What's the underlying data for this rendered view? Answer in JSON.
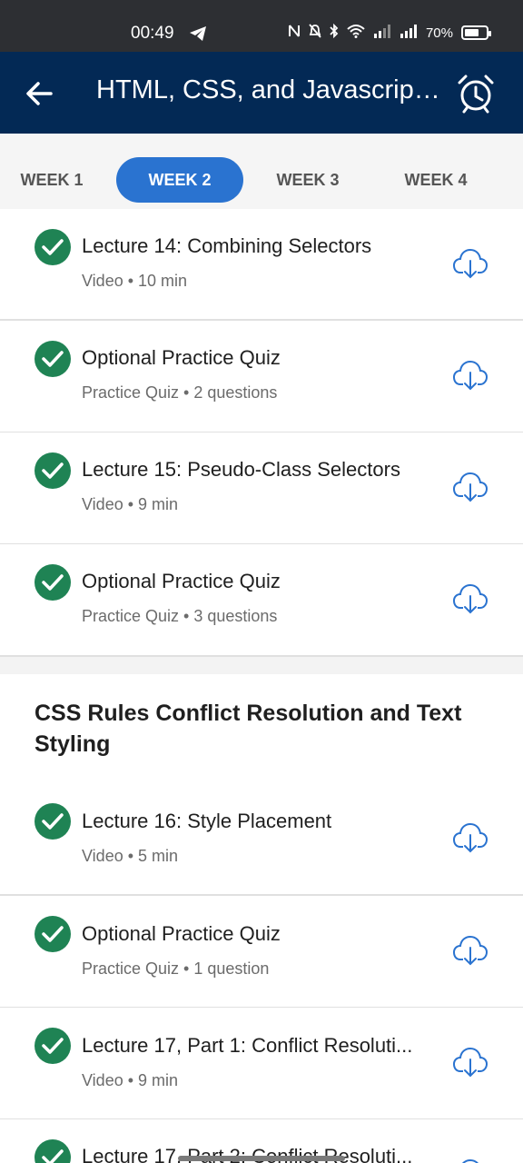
{
  "status_bar": {
    "time": "00:49",
    "battery": "70%",
    "battery_level": 0.7
  },
  "app_bar": {
    "title": "HTML, CSS, and Javascript f..."
  },
  "tabs": [
    {
      "label": "WEEK 1",
      "active": false
    },
    {
      "label": "WEEK 2",
      "active": true
    },
    {
      "label": "WEEK 3",
      "active": false
    },
    {
      "label": "WEEK 4",
      "active": false
    }
  ],
  "group1": {
    "items": [
      {
        "title": "Lecture 14: Combining Selectors",
        "subtitle": "Video • 10 min"
      },
      {
        "title": "Optional Practice Quiz",
        "subtitle": "Practice Quiz • 2 questions"
      },
      {
        "title": "Lecture 15: Pseudo-Class Selectors",
        "subtitle": "Video • 9 min"
      },
      {
        "title": "Optional Practice Quiz",
        "subtitle": "Practice Quiz • 3 questions"
      }
    ]
  },
  "group2": {
    "title": "CSS Rules Conflict Resolution and Text Styling",
    "items": [
      {
        "title": "Lecture 16: Style Placement",
        "subtitle": "Video • 5 min"
      },
      {
        "title": "Optional Practice Quiz",
        "subtitle": "Practice Quiz • 1 question"
      },
      {
        "title": "Lecture 17, Part 1: Conflict Resoluti...",
        "subtitle": "Video • 9 min"
      },
      {
        "title": "Lecture 17, Part 2: Conflict Resoluti...",
        "subtitle": ""
      }
    ]
  },
  "colors": {
    "app_bar": "#032955",
    "active_tab": "#2a73d0",
    "check": "#1f8354",
    "download": "#2a73d0"
  },
  "icons": {
    "back": "arrow-left-icon",
    "alarm": "alarm-clock-icon",
    "completed": "check-circle-icon",
    "download": "cloud-download-icon"
  }
}
